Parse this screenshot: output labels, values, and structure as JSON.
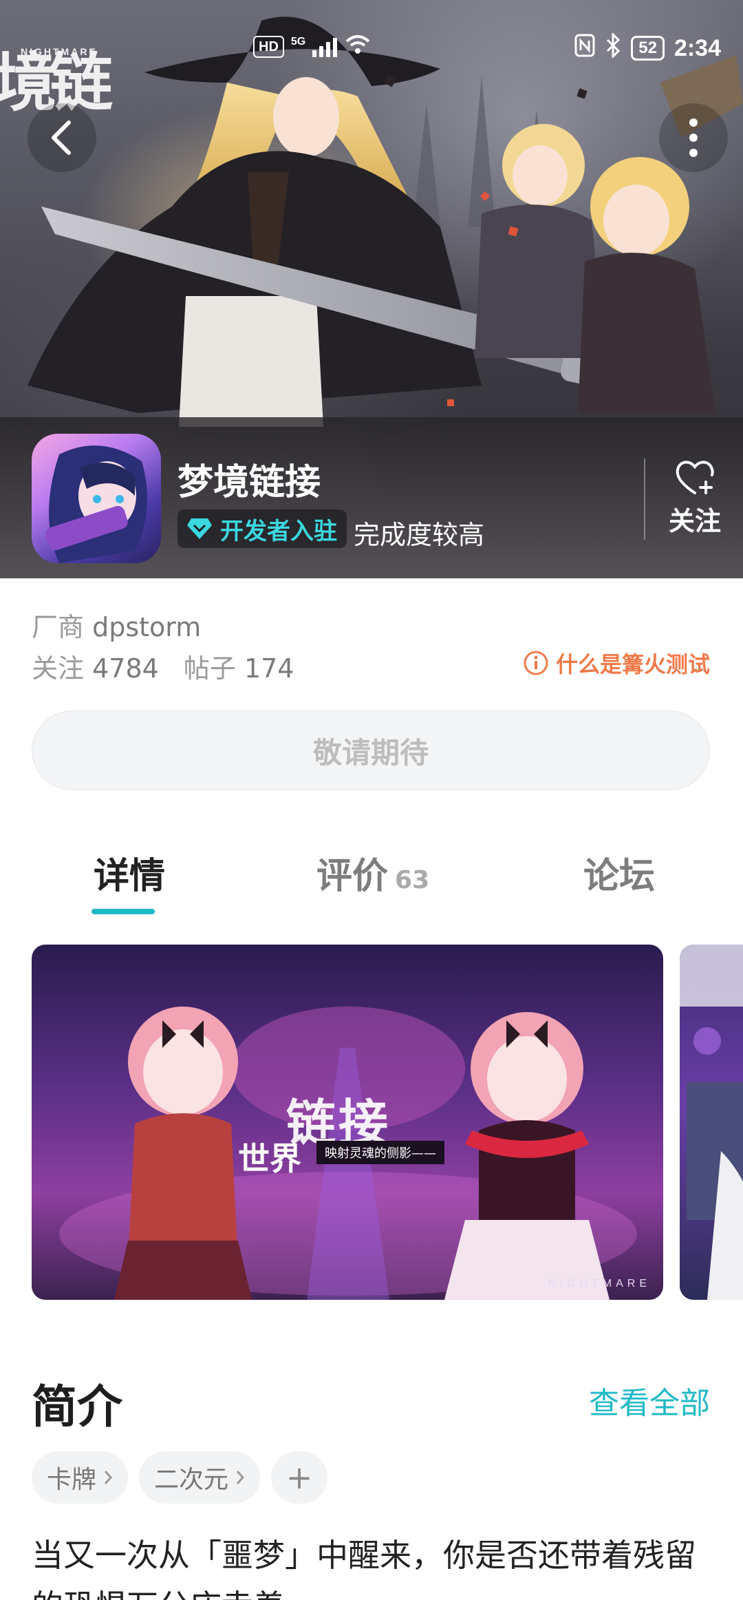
{
  "status_bar": {
    "hd": "HD",
    "net": "5G",
    "battery": "52",
    "time": "2:34"
  },
  "hero": {
    "logo_small": "NIGHTMARE",
    "logo_big": "境链接"
  },
  "game": {
    "title": "梦境链接",
    "dev_badge": "开发者入驻",
    "completion": "完成度较高",
    "follow_label": "关注"
  },
  "info": {
    "vendor_label": "厂商",
    "vendor_name": "dpstorm",
    "follow_label": "关注",
    "follow_count": "4784",
    "posts_label": "帖子",
    "posts_count": "174",
    "bonfire_link": "什么是篝火测试"
  },
  "action": {
    "label": "敬请期待"
  },
  "tabs": [
    {
      "label": "详情"
    },
    {
      "label": "评价",
      "count": "63"
    },
    {
      "label": "论坛"
    }
  ],
  "screenshot": {
    "title_big": "链接",
    "title_small": "世界",
    "subtitle": "映射灵魂的侧影——",
    "brand": "NIGHTMARE"
  },
  "intro": {
    "title": "简介",
    "view_all": "查看全部",
    "tags": [
      "卡牌",
      "二次元"
    ],
    "add_tag": "+",
    "text": "当又一次从「噩梦」中醒来，你是否还带着残留的恐惧万分庆幸着——"
  },
  "colors": {
    "accent": "#20b9c6",
    "warning": "#f07a4a",
    "badge_text": "#3bd7df"
  }
}
